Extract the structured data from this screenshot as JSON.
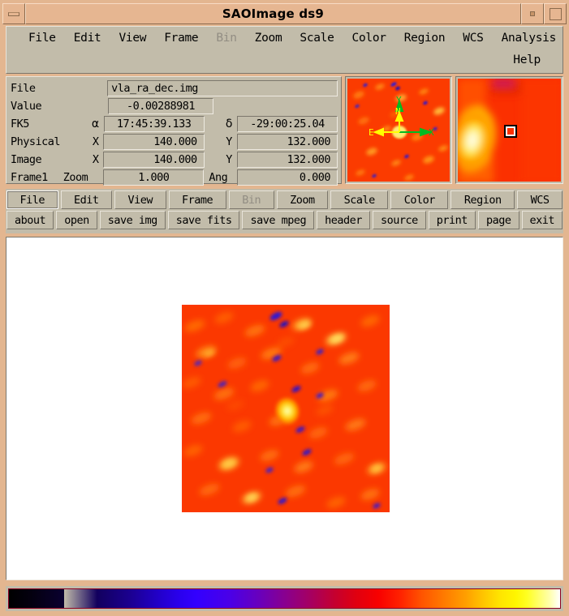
{
  "window": {
    "title": "SAOImage ds9",
    "minimize_icon": "minimize-icon",
    "shade_icon": "shade-icon",
    "maximize_icon": "maximize-icon"
  },
  "menubar": {
    "items": [
      {
        "label": "File",
        "disabled": false
      },
      {
        "label": "Edit",
        "disabled": false
      },
      {
        "label": "View",
        "disabled": false
      },
      {
        "label": "Frame",
        "disabled": false
      },
      {
        "label": "Bin",
        "disabled": true
      },
      {
        "label": "Zoom",
        "disabled": false
      },
      {
        "label": "Scale",
        "disabled": false
      },
      {
        "label": "Color",
        "disabled": false
      },
      {
        "label": "Region",
        "disabled": false
      },
      {
        "label": "WCS",
        "disabled": false
      },
      {
        "label": "Analysis",
        "disabled": false
      }
    ],
    "help_label": "Help"
  },
  "info_panel": {
    "file_label": "File",
    "file_value": "vla_ra_dec.img",
    "value_label": "Value",
    "value_value": "-0.00288981",
    "wcs_system_label": "FK5",
    "alpha_symbol": "α",
    "alpha_value": "17:45:39.133",
    "delta_symbol": "δ",
    "delta_value": "-29:00:25.04",
    "physical_label": "Physical",
    "physical_x_label": "X",
    "physical_x_value": "140.000",
    "physical_y_label": "Y",
    "physical_y_value": "132.000",
    "image_label": "Image",
    "image_x_label": "X",
    "image_x_value": "140.000",
    "image_y_label": "Y",
    "image_y_value": "132.000",
    "frame_label": "Frame1",
    "zoom_label": "Zoom",
    "zoom_value": "1.000",
    "angle_label": "Ang",
    "angle_value": "0.000"
  },
  "panner": {
    "name": "panner",
    "compass_north": "N",
    "compass_east": "E",
    "axis_x": "X",
    "axis_y": "Y",
    "compass_color": "#ffff00",
    "axis_color": "#00bb22"
  },
  "magnifier": {
    "name": "magnifier",
    "cursor_box": "cursor-box"
  },
  "button_bar": {
    "menu_buttons": [
      {
        "label": "File",
        "active": true,
        "disabled": false
      },
      {
        "label": "Edit",
        "active": false,
        "disabled": false
      },
      {
        "label": "View",
        "active": false,
        "disabled": false
      },
      {
        "label": "Frame",
        "active": false,
        "disabled": false
      },
      {
        "label": "Bin",
        "active": false,
        "disabled": true
      },
      {
        "label": "Zoom",
        "active": false,
        "disabled": false
      },
      {
        "label": "Scale",
        "active": false,
        "disabled": false
      },
      {
        "label": "Color",
        "active": false,
        "disabled": false
      },
      {
        "label": "Region",
        "active": false,
        "disabled": false
      },
      {
        "label": "WCS",
        "active": false,
        "disabled": false
      }
    ],
    "file_buttons": [
      {
        "label": "about"
      },
      {
        "label": "open"
      },
      {
        "label": "save img"
      },
      {
        "label": "save fits"
      },
      {
        "label": "save mpeg"
      },
      {
        "label": "header"
      },
      {
        "label": "source"
      },
      {
        "label": "print"
      },
      {
        "label": "page"
      },
      {
        "label": "exit"
      }
    ]
  },
  "canvas": {
    "name": "image-display",
    "background": "#ffffff",
    "frame_name": "frame1-image"
  },
  "colorbar": {
    "name": "colorbar",
    "colormap": "b",
    "stops": [
      "#000000",
      "#3300ff",
      "#880090",
      "#f80000",
      "#ffa000",
      "#ffff00",
      "#ffffff"
    ],
    "border_color": "#8b0020"
  },
  "theme": {
    "titlebar_bg": "#e6b691",
    "window_bg": "#e3b690",
    "widget_bg": "#c2bcaa",
    "shadow": "#7c776c",
    "highlight": "#e8e4da",
    "text": "#000000",
    "disabled_text": "#928d83"
  }
}
